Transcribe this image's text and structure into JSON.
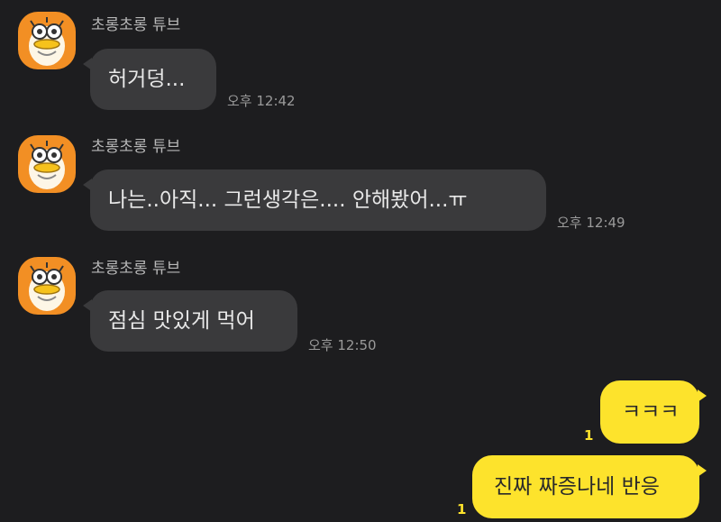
{
  "chat": {
    "accent_color": "#fde32c",
    "incoming": [
      {
        "sender": "초롱초롱 튜브",
        "text": "허거덩...",
        "time": "오후 12:42",
        "avatar_icon": "duck-character-icon"
      },
      {
        "sender": "초롱초롱 튜브",
        "text": "나는..아직... 그런생각은.... 안해봤어...ㅠ",
        "time": "오후 12:49",
        "avatar_icon": "duck-character-icon"
      },
      {
        "sender": "초롱초롱 튜브",
        "text": "점심 맛있게 먹어",
        "time": "오후 12:50",
        "avatar_icon": "duck-character-icon"
      }
    ],
    "outgoing": [
      {
        "text": "ㅋㅋㅋ",
        "unread": "1"
      },
      {
        "text": "진짜 짜증나네 반응",
        "unread": "1"
      }
    ]
  }
}
